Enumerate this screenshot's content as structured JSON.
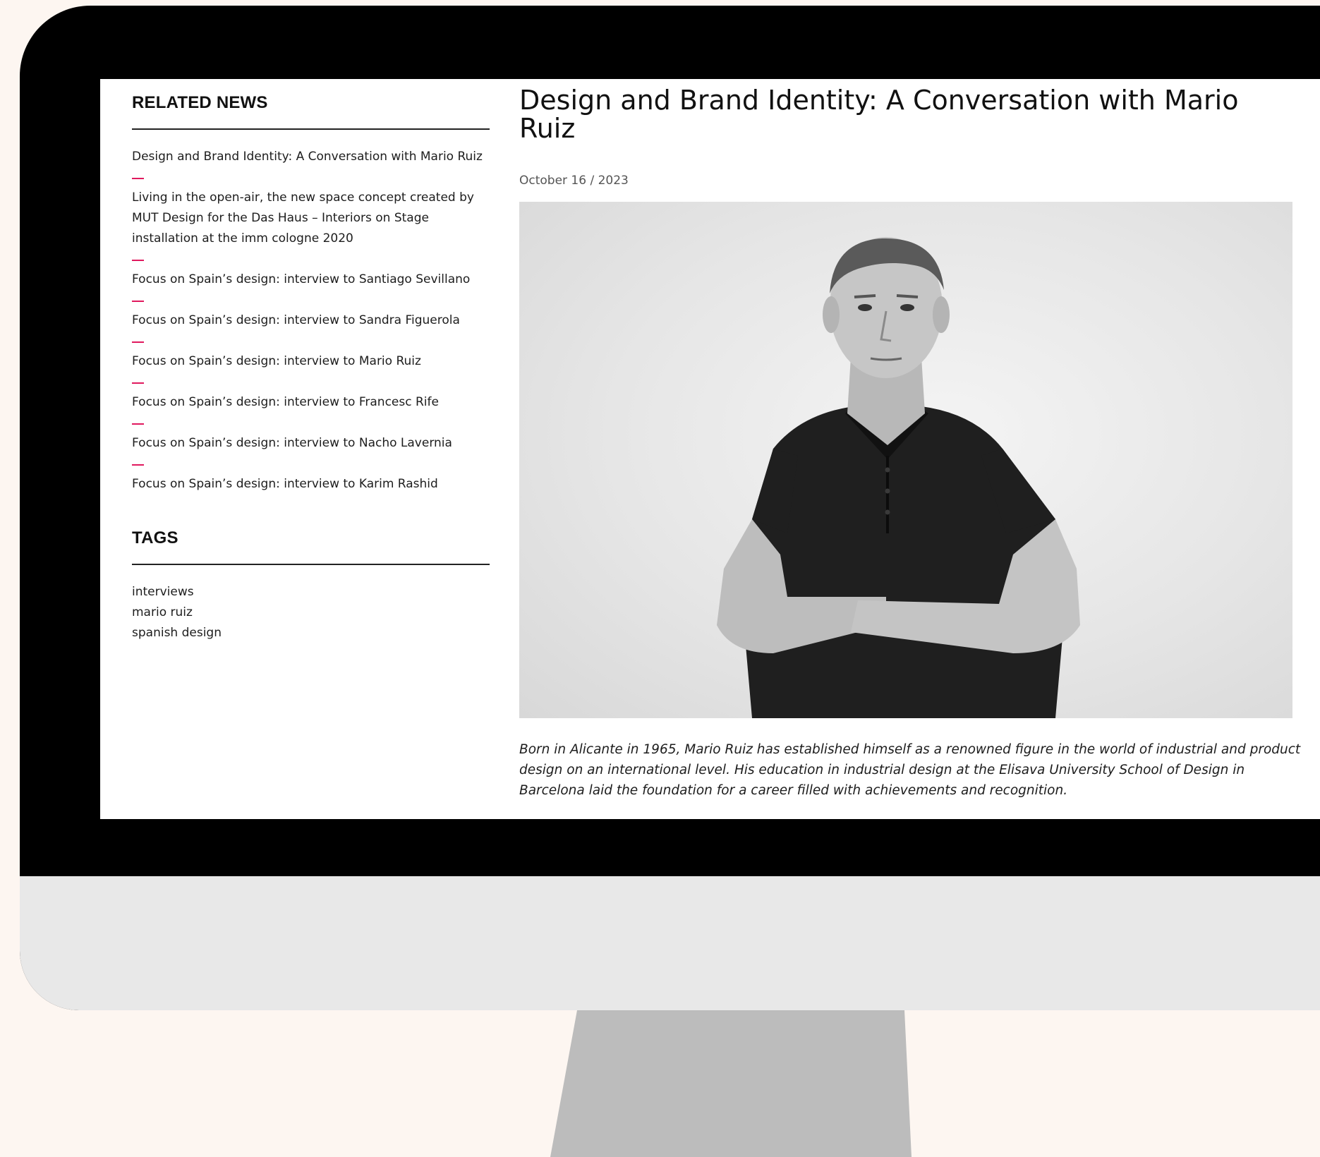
{
  "sidebar": {
    "related_heading": "RELATED NEWS",
    "related_items": [
      "Design and Brand Identity: A Conversation with Mario Ruiz",
      "Living in the open-air, the new space concept created by MUT Design for the Das Haus – Interiors on Stage installation at the imm cologne 2020",
      "Focus on Spain’s design: interview to Santiago Sevillano",
      "Focus on Spain’s design: interview to Sandra Figuerola",
      "Focus on Spain’s design: interview to Mario Ruiz",
      "Focus on Spain’s design: interview to Francesc Rife",
      "Focus on Spain’s design: interview to Nacho Lavernia",
      "Focus on Spain’s design: interview to Karim Rashid"
    ],
    "tags_heading": "TAGS",
    "tags": [
      "interviews",
      "mario ruiz",
      "spanish design"
    ]
  },
  "article": {
    "title": "Design and Brand Identity: A Conversation with Mario Ruiz",
    "date": "October 16 / 2023",
    "lead": "Born in Alicante in 1965, Mario Ruiz has established himself as a renowned figure in the world of industrial and product design on an international level. His education in industrial design at the Elisava University School of Design in Barcelona laid the foundation for a career filled with achievements and recognition."
  },
  "colors": {
    "accent": "#e0195e",
    "page_background": "#fdf6f1",
    "bezel": "#000000",
    "chin": "#e8e8e8",
    "stand": "#bcbcbc"
  }
}
